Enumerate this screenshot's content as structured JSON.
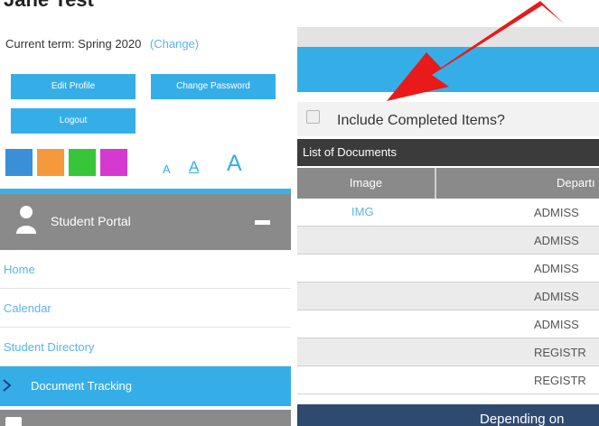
{
  "page": {
    "cut_title": "Jane Test",
    "term_prefix": "Current term: Spring 2020",
    "term_change": "(Change)"
  },
  "profile": {
    "edit_profile": "Edit Profile",
    "change_password": "Change Password",
    "logout": "Logout"
  },
  "theme_swatches": [
    "#3a8fd8",
    "#f59a3a",
    "#37c63a",
    "#d43ad0"
  ],
  "font_sizes": [
    "A",
    "A",
    "A"
  ],
  "portal": {
    "label": "Student Portal",
    "collapse_icon": "minus-icon",
    "user_icon": "user-icon"
  },
  "nav": {
    "home": "Home",
    "calendar": "Calendar",
    "directory": "Student Directory",
    "doc_tracking": "Document Tracking"
  },
  "documents": {
    "include_completed": "Include Completed Items?",
    "list_title": "List of Documents",
    "columns": [
      "Image",
      "Departı"
    ],
    "rows": [
      {
        "image": "IMG",
        "department": "ADMISS"
      },
      {
        "image": "",
        "department": "ADMISS"
      },
      {
        "image": "",
        "department": "ADMISS"
      },
      {
        "image": "",
        "department": "ADMISS"
      },
      {
        "image": "",
        "department": "ADMISS"
      },
      {
        "image": "",
        "department": "REGISTR"
      },
      {
        "image": "",
        "department": "REGISTR"
      }
    ],
    "footer_text": "Depending on"
  },
  "colors": {
    "accent_blue": "#35aee8",
    "link_blue": "#5ab4e8",
    "gray_bar": "#8a8a8a",
    "dark_header": "#3b3b3b",
    "footer_navy": "#2e4a6e",
    "annotation_arrow": "#e81a1a"
  }
}
